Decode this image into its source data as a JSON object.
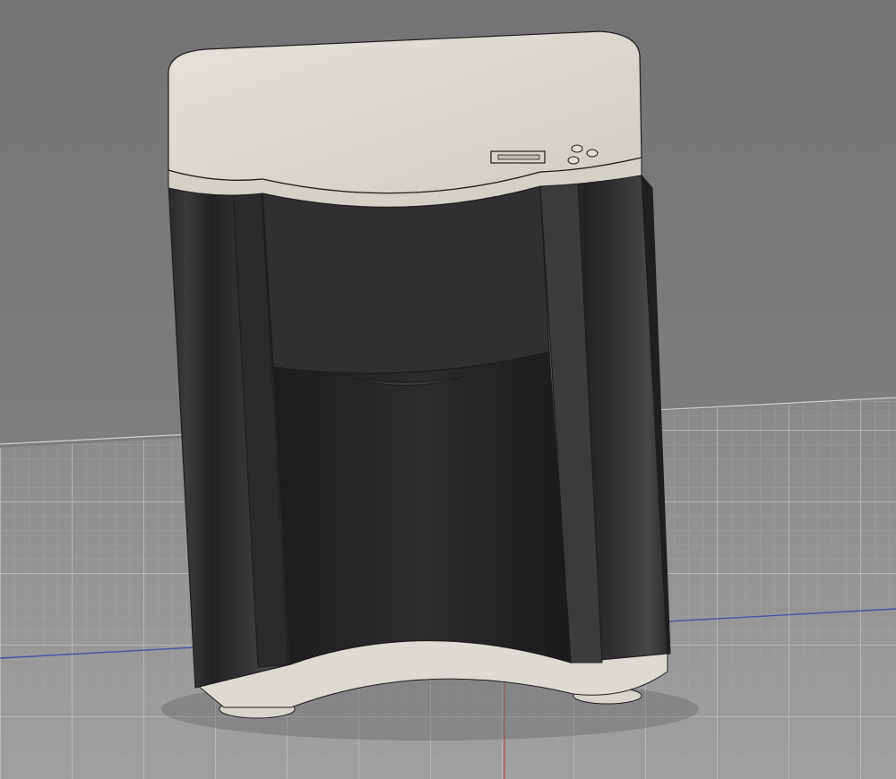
{
  "viewport": {
    "label": "",
    "background_color": "#7a7a7a",
    "grid_color": "#8d8d8d",
    "grid_line_color": "#a4a4a4",
    "axis_x_color": "#4b56a8",
    "axis_z_color": "#b34e4e"
  },
  "model": {
    "name": "",
    "body_color": "#2f2f2f",
    "top_color": "#d8d6cd",
    "edge_color": "#1d1d1d",
    "highlight_color": "#4a4a4a"
  },
  "icons": [
    {
      "name": "slot-icon",
      "meaning": "display-slot"
    },
    {
      "name": "button-cluster-icon",
      "meaning": "three-buttons"
    }
  ]
}
